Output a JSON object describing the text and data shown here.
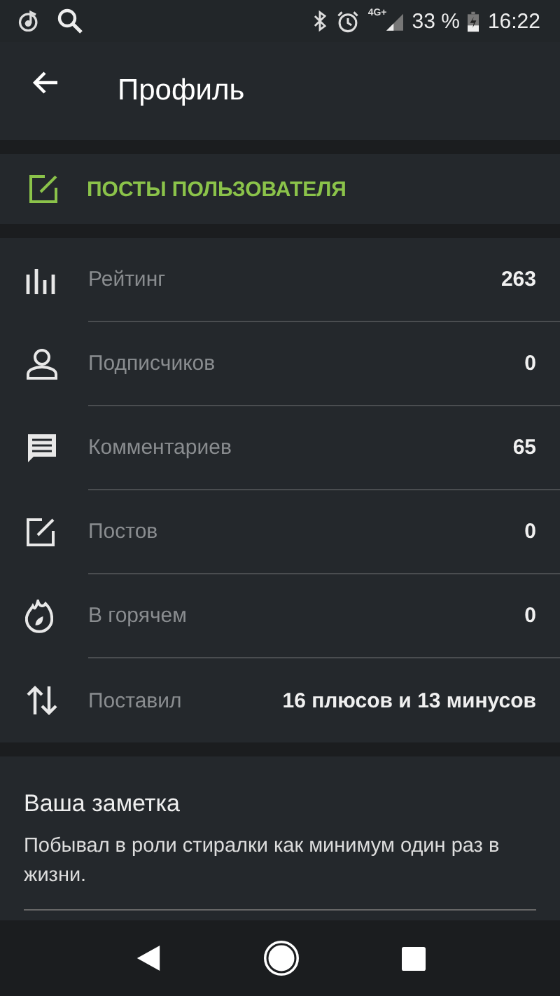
{
  "status_bar": {
    "network": "4G+",
    "battery": "33 %",
    "time": "16:22"
  },
  "app_bar": {
    "title": "Профиль"
  },
  "posts_button": {
    "label": "ПОСТЫ ПОЛЬЗОВАТЕЛЯ"
  },
  "stats": [
    {
      "kind": "rating",
      "label": "Рейтинг",
      "value": "263"
    },
    {
      "kind": "subscribers",
      "label": "Подписчиков",
      "value": "0"
    },
    {
      "kind": "comments",
      "label": "Комментариев",
      "value": "65"
    },
    {
      "kind": "posts",
      "label": "Постов",
      "value": "0"
    },
    {
      "kind": "hot",
      "label": "В горячем",
      "value": "0"
    },
    {
      "kind": "votes",
      "label": "Поставил",
      "value": "16 плюсов и 13 минусов"
    }
  ],
  "note": {
    "title": "Ваша заметка",
    "text": "Побывал в роли стиралки как минимум один раз в жизни."
  }
}
